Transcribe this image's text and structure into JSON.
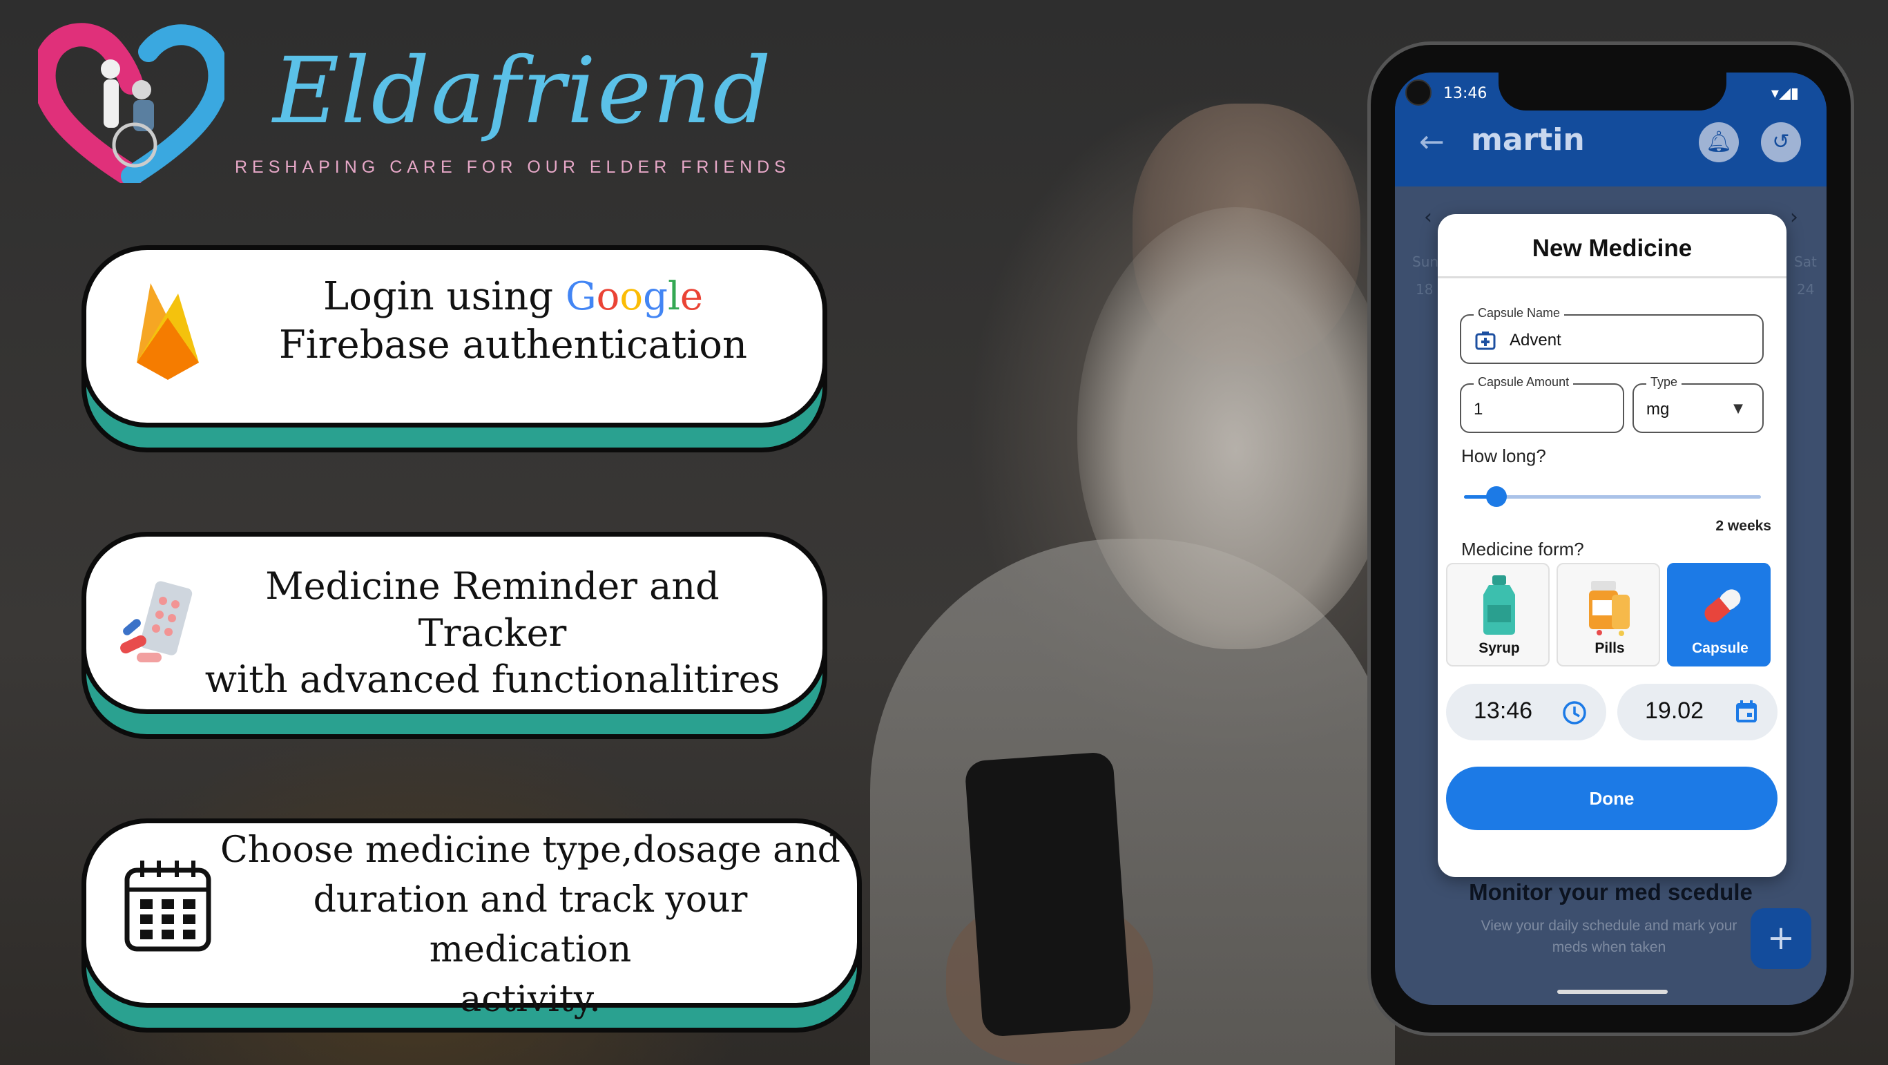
{
  "brand": {
    "name": "Eldafriend",
    "tagline": "RESHAPING CARE FOR OUR ELDER FRIENDS"
  },
  "features": [
    {
      "line1_prefix": "Login using ",
      "google": [
        "G",
        "o",
        "o",
        "g",
        "l",
        "e"
      ],
      "line2": "Firebase authentication",
      "icon": "firebase-icon"
    },
    {
      "line1": "Medicine Reminder and Tracker",
      "line2": "with advanced functionalitires",
      "icon": "pills-icon"
    },
    {
      "line1": "Choose medicine type,dosage and",
      "line2": "duration and track your medication",
      "line3": "activity.",
      "icon": "calendar-icon"
    }
  ],
  "phone": {
    "status_time": "13:46",
    "appbar_title": "martin",
    "calendar": {
      "left_day": "Sun",
      "left_date": "18",
      "right_day": "Sat",
      "right_date": "24",
      "prev": "‹",
      "next": "›"
    },
    "dialog": {
      "title": "New Medicine",
      "capsule_name_label": "Capsule Name",
      "capsule_name_value": "Advent",
      "capsule_amount_label": "Capsule Amount",
      "capsule_amount_value": "1",
      "type_label": "Type",
      "type_value": "mg",
      "how_long_label": "How long?",
      "how_long_value": "2 weeks",
      "how_long_fraction": 0.11,
      "form_label": "Medicine form?",
      "forms": [
        {
          "label": "Syrup",
          "selected": false
        },
        {
          "label": "Pills",
          "selected": false
        },
        {
          "label": "Capsule",
          "selected": true
        }
      ],
      "time_value": "13:46",
      "date_value": "19.02",
      "done_label": "Done"
    },
    "monitor_title": "Monitor your med scedule",
    "monitor_subtitle": "View your daily schedule and mark your meds when taken",
    "fab_label": "+"
  },
  "colors": {
    "brand_blue": "#5bc1e8",
    "card_teal": "#2aa190",
    "app_primary": "#1c7ae6",
    "appbar": "#134c9c"
  }
}
